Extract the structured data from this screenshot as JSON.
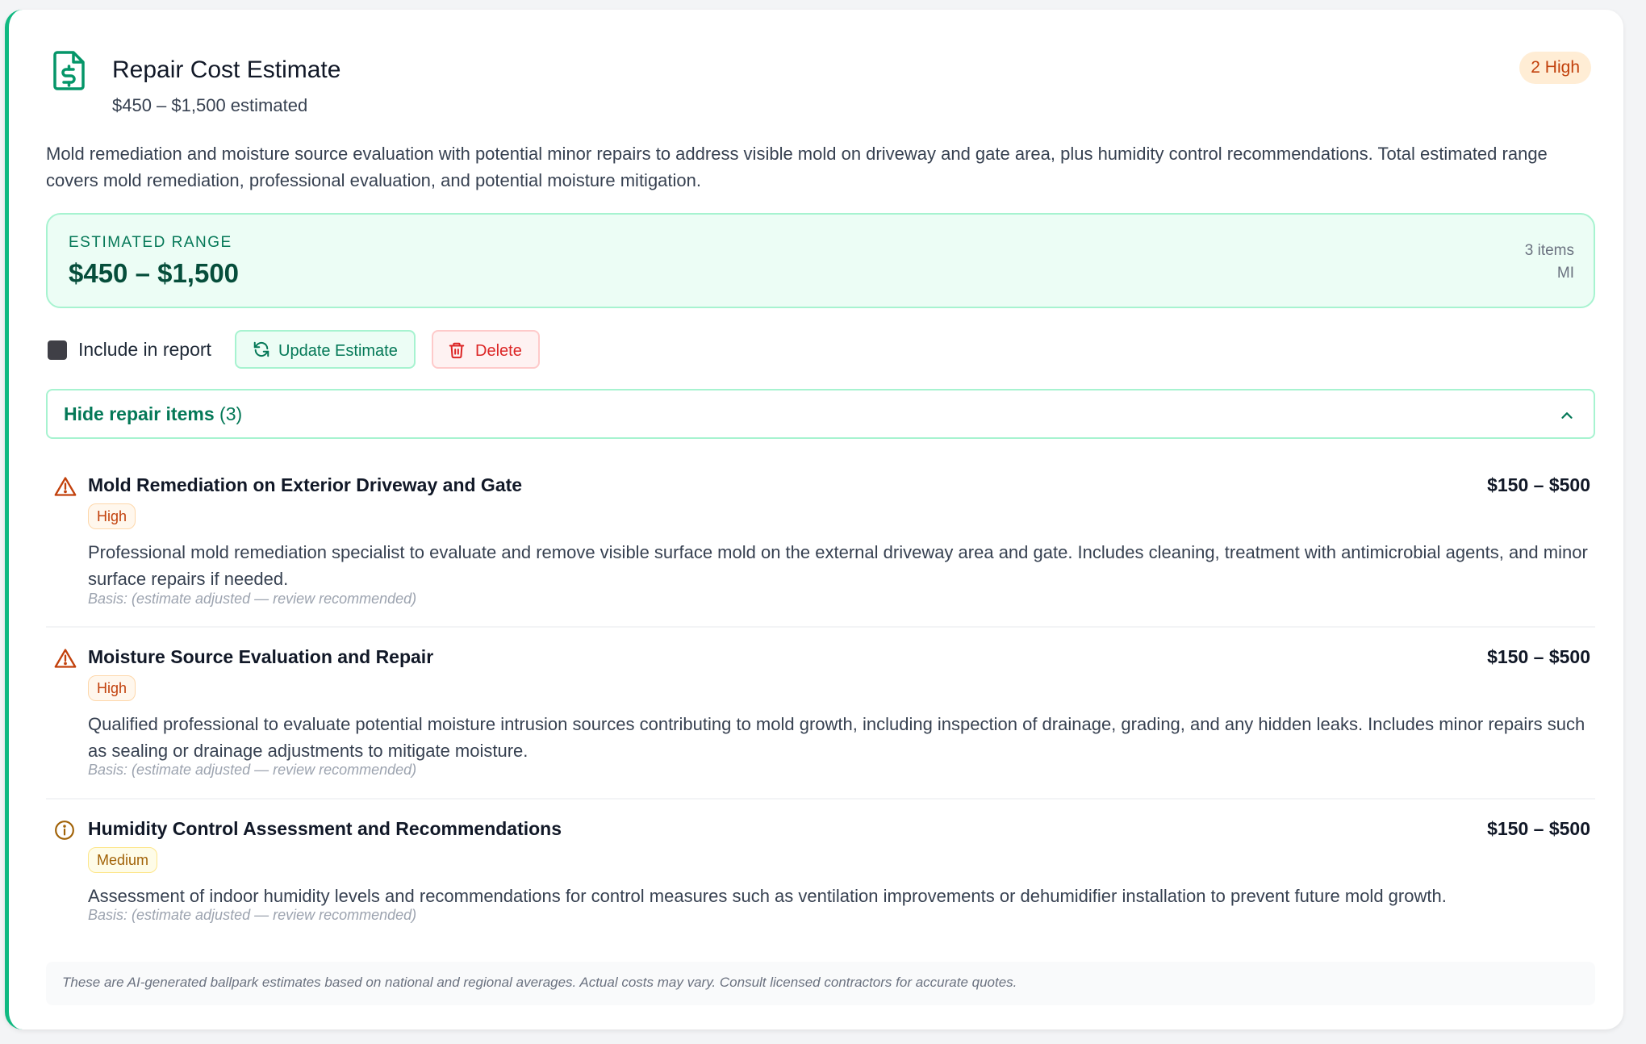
{
  "header": {
    "title": "Repair Cost Estimate",
    "subtitle": "$450 – $1,500 estimated",
    "severity_badge": "2 High",
    "icon": "file-dollar-icon"
  },
  "summary": "Mold remediation and moisture source evaluation with potential minor repairs to address visible mold on driveway and gate area, plus humidity control recommendations. Total estimated range covers mold remediation, professional evaluation, and potential moisture mitigation.",
  "range": {
    "label": "ESTIMATED RANGE",
    "value": "$450 – $1,500",
    "items": "3 items",
    "state": "MI"
  },
  "actions": {
    "include_label": "Include in report",
    "include_checked": false,
    "update_label": "Update Estimate",
    "delete_label": "Delete"
  },
  "toggle": {
    "label": "Hide repair items",
    "count": "(3)"
  },
  "items": [
    {
      "title": "Mold Remediation on Exterior Driveway and Gate",
      "price": "$150 – $500",
      "severity": "High",
      "icon": "warning-triangle-icon",
      "description": "Professional mold remediation specialist to evaluate and remove visible surface mold on the external driveway area and gate. Includes cleaning, treatment with antimicrobial agents, and minor surface repairs if needed.",
      "basis": "Basis: (estimate adjusted — review recommended)"
    },
    {
      "title": "Moisture Source Evaluation and Repair",
      "price": "$150 – $500",
      "severity": "High",
      "icon": "warning-triangle-icon",
      "description": "Qualified professional to evaluate potential moisture intrusion sources contributing to mold growth, including inspection of drainage, grading, and any hidden leaks. Includes minor repairs such as sealing or drainage adjustments to mitigate moisture.",
      "basis": "Basis: (estimate adjusted — review recommended)"
    },
    {
      "title": "Humidity Control Assessment and Recommendations",
      "price": "$150 – $500",
      "severity": "Medium",
      "icon": "info-circle-icon",
      "description": "Assessment of indoor humidity levels and recommendations for control measures such as ventilation improvements or dehumidifier installation to prevent future mold growth.",
      "basis": "Basis: (estimate adjusted — review recommended)"
    }
  ],
  "footnote": "These are AI-generated ballpark estimates based on national and regional averages. Actual costs may vary. Consult licensed contractors for accurate quotes.",
  "colors": {
    "accent": "#10b981",
    "accent_dark": "#047857",
    "high": "#c2410c",
    "medium": "#a16207",
    "danger": "#dc2626"
  }
}
